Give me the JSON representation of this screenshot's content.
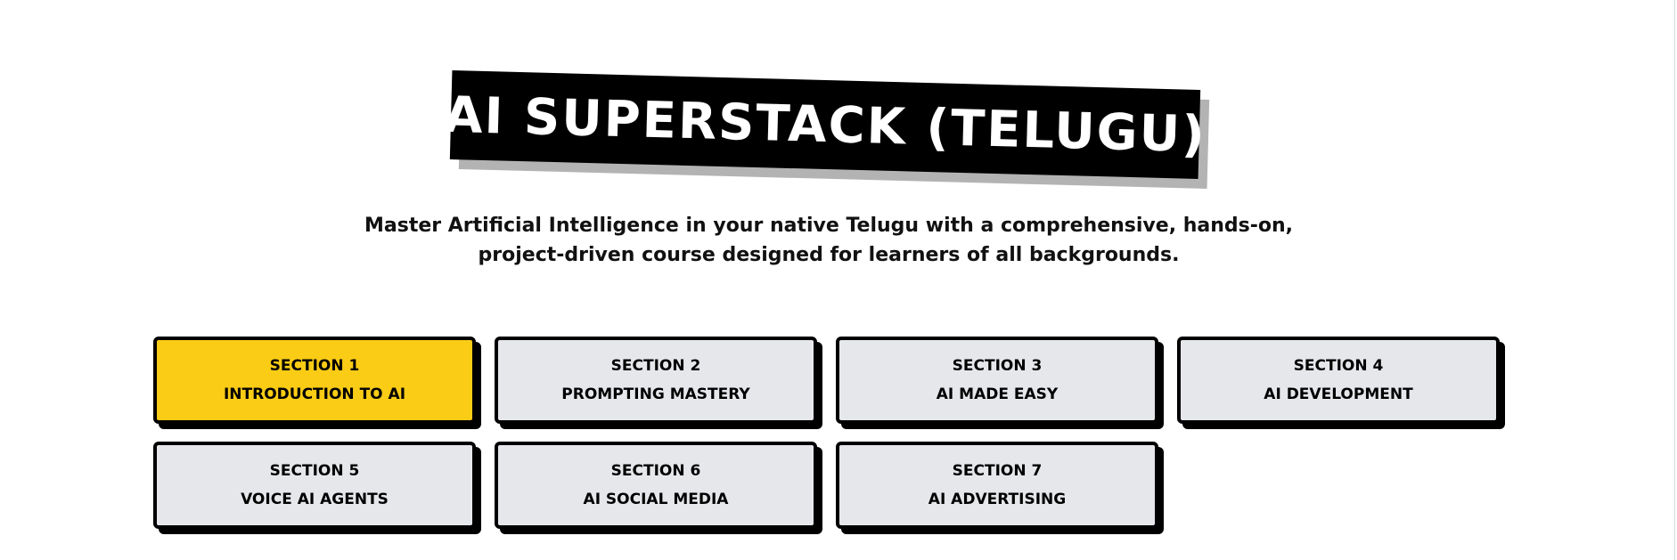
{
  "header": {
    "title": "AI SUPERSTACK (TELUGU)",
    "subtitle_line1": "Master Artificial Intelligence in your native Telugu with a comprehensive, hands-on,",
    "subtitle_line2": "project-driven course designed for learners of all backgrounds."
  },
  "colors": {
    "active_card": "#facc15",
    "inactive_card": "#e5e7eb",
    "title_background": "#000000",
    "title_shadow": "#b3b3b3"
  },
  "sections": [
    {
      "label": "SECTION 1",
      "title": "INTRODUCTION TO AI",
      "active": true
    },
    {
      "label": "SECTION 2",
      "title": "PROMPTING MASTERY",
      "active": false
    },
    {
      "label": "SECTION 3",
      "title": "AI MADE EASY",
      "active": false
    },
    {
      "label": "SECTION 4",
      "title": "AI DEVELOPMENT",
      "active": false
    },
    {
      "label": "SECTION 5",
      "title": "VOICE AI AGENTS",
      "active": false
    },
    {
      "label": "SECTION 6",
      "title": "AI SOCIAL MEDIA",
      "active": false
    },
    {
      "label": "SECTION 7",
      "title": "AI ADVERTISING",
      "active": false
    }
  ]
}
